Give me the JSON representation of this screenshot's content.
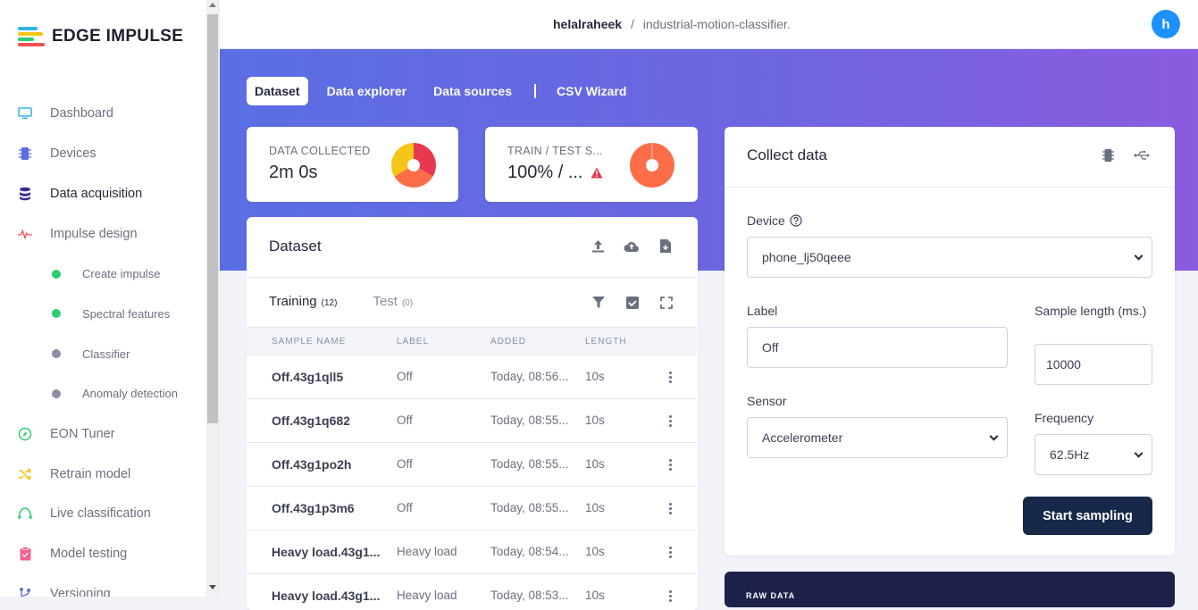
{
  "app": {
    "logo_text": "EDGE IMPULSE"
  },
  "breadcrumb": {
    "user": "helalraheek",
    "separator": "/",
    "project": "industrial-motion-classifier."
  },
  "user": {
    "avatar_initial": "h"
  },
  "sidebar": {
    "items": [
      {
        "label": "Dashboard",
        "icon": "monitor-icon",
        "color": "#3ab7e3"
      },
      {
        "label": "Devices",
        "icon": "chip-icon",
        "color": "#5b6ee1"
      },
      {
        "label": "Data acquisition",
        "icon": "database-icon",
        "color": "#3b2f8f",
        "active": true
      },
      {
        "label": "Impulse design",
        "icon": "pulse-icon",
        "color": "#f0524f"
      },
      {
        "label": "Create impulse",
        "sub": true,
        "dot": "#2ecc71"
      },
      {
        "label": "Spectral features",
        "sub": true,
        "dot": "#2ecc71"
      },
      {
        "label": "Classifier",
        "sub": true,
        "dot": "#8a8fa3"
      },
      {
        "label": "Anomaly detection",
        "sub": true,
        "dot": "#8a8fa3"
      },
      {
        "label": "EON Tuner",
        "icon": "compass-icon",
        "color": "#2ecc71"
      },
      {
        "label": "Retrain model",
        "icon": "shuffle-icon",
        "color": "#f5c518"
      },
      {
        "label": "Live classification",
        "icon": "signal-icon",
        "color": "#2ecc71"
      },
      {
        "label": "Model testing",
        "icon": "clipboard-icon",
        "color": "#f06292"
      },
      {
        "label": "Versioning",
        "icon": "branch-icon",
        "color": "#5b6ee1"
      }
    ]
  },
  "tabs": [
    {
      "label": "Dataset",
      "active": true
    },
    {
      "label": "Data explorer"
    },
    {
      "label": "Data sources"
    },
    {
      "label": "CSV Wizard"
    }
  ],
  "stats": {
    "data_collected": {
      "label": "DATA COLLECTED",
      "value": "2m 0s"
    },
    "train_test": {
      "label": "TRAIN / TEST S...",
      "value": "100% / ..."
    }
  },
  "dataset": {
    "title": "Dataset",
    "training_tab": {
      "label": "Training",
      "count": "(12)"
    },
    "test_tab": {
      "label": "Test",
      "count": "(0)"
    },
    "columns": [
      "SAMPLE NAME",
      "LABEL",
      "ADDED",
      "LENGTH"
    ],
    "rows": [
      {
        "name": "Off.43g1qll5",
        "label": "Off",
        "added": "Today, 08:56...",
        "length": "10s"
      },
      {
        "name": "Off.43g1q682",
        "label": "Off",
        "added": "Today, 08:55...",
        "length": "10s"
      },
      {
        "name": "Off.43g1po2h",
        "label": "Off",
        "added": "Today, 08:55...",
        "length": "10s"
      },
      {
        "name": "Off.43g1p3m6",
        "label": "Off",
        "added": "Today, 08:55...",
        "length": "10s"
      },
      {
        "name": "Heavy load.43g1...",
        "label": "Heavy load",
        "added": "Today, 08:54...",
        "length": "10s"
      },
      {
        "name": "Heavy load.43g1...",
        "label": "Heavy load",
        "added": "Today, 08:53...",
        "length": "10s"
      }
    ]
  },
  "collect": {
    "title": "Collect data",
    "device_label": "Device",
    "device_value": "phone_lj50qeee",
    "label_label": "Label",
    "label_value": "Off",
    "sample_length_label": "Sample length (ms.)",
    "sample_length_value": "10000",
    "sensor_label": "Sensor",
    "sensor_value": "Accelerometer",
    "frequency_label": "Frequency",
    "frequency_value": "62.5Hz",
    "start_button": "Start sampling"
  },
  "raw_data": {
    "title": "RAW DATA"
  },
  "colors": {
    "accent_dark": "#172848",
    "hero_start": "#5a6ee3",
    "hero_end": "#8a5cdf",
    "warning": "#e53950"
  }
}
